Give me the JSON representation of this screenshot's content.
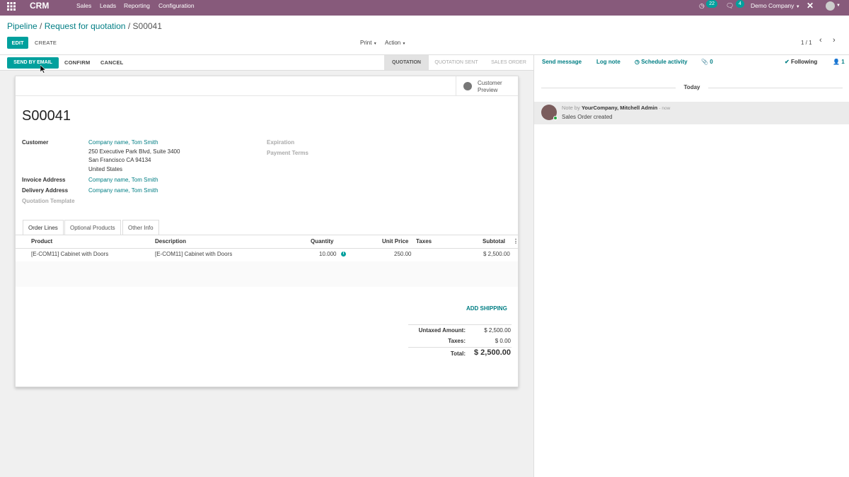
{
  "navbar": {
    "app_name": "CRM",
    "menu": [
      "Sales",
      "Leads",
      "Reporting",
      "Configuration"
    ],
    "activity_count": "22",
    "message_count": "4",
    "company": "Demo Company"
  },
  "breadcrumb": {
    "pipeline": "Pipeline",
    "sep1": "/",
    "rfq": "Request for quotation",
    "sep2": "/",
    "current": "S00041"
  },
  "buttons": {
    "edit": "EDIT",
    "create": "CREATE",
    "print": "Print",
    "action": "Action",
    "pager": "1 / 1",
    "send_by_email": "SEND BY EMAIL",
    "confirm": "CONFIRM",
    "cancel": "CANCEL"
  },
  "stages": [
    {
      "label": "QUOTATION",
      "active": true
    },
    {
      "label": "QUOTATION SENT",
      "active": false
    },
    {
      "label": "SALES ORDER",
      "active": false
    }
  ],
  "customer_preview": {
    "line1": "Customer",
    "line2": "Preview"
  },
  "order": {
    "name": "S00041",
    "customer_label": "Customer",
    "customer_name": "Company name, Tom Smith",
    "address1": "250 Executive Park Blvd, Suite 3400",
    "address2": "San Francisco CA 94134",
    "address3": "United States",
    "invoice_label": "Invoice Address",
    "invoice_value": "Company name, Tom Smith",
    "delivery_label": "Delivery Address",
    "delivery_value": "Company name, Tom Smith",
    "template_label": "Quotation Template",
    "expiration_label": "Expiration",
    "payment_terms_label": "Payment Terms"
  },
  "tabs": [
    "Order Lines",
    "Optional Products",
    "Other Info"
  ],
  "table": {
    "headers": {
      "product": "Product",
      "description": "Description",
      "quantity": "Quantity",
      "unit_price": "Unit Price",
      "taxes": "Taxes",
      "subtotal": "Subtotal"
    },
    "rows": [
      {
        "product": "[E-COM11] Cabinet with Doors",
        "description": "[E-COM11] Cabinet with Doors",
        "quantity": "10.000",
        "unit_price": "250.00",
        "taxes": "",
        "subtotal": "$ 2,500.00"
      }
    ]
  },
  "add_shipping": "ADD SHIPPING",
  "totals": {
    "untaxed_label": "Untaxed Amount:",
    "untaxed_value": "$ 2,500.00",
    "taxes_label": "Taxes:",
    "taxes_value": "$ 0.00",
    "total_label": "Total:",
    "total_value": "$ 2,500.00"
  },
  "chatter": {
    "send_message": "Send message",
    "log_note": "Log note",
    "schedule_activity": "Schedule activity",
    "attachments": "0",
    "following": "Following",
    "followers": "1",
    "date_separator": "Today",
    "message": {
      "prefix": "Note by",
      "author": "YourCompany, Mitchell Admin",
      "time": "- now",
      "body": "Sales Order created"
    }
  },
  "colors": {
    "brand": "#875a7b",
    "accent": "#00a09d",
    "link": "#017e84"
  }
}
